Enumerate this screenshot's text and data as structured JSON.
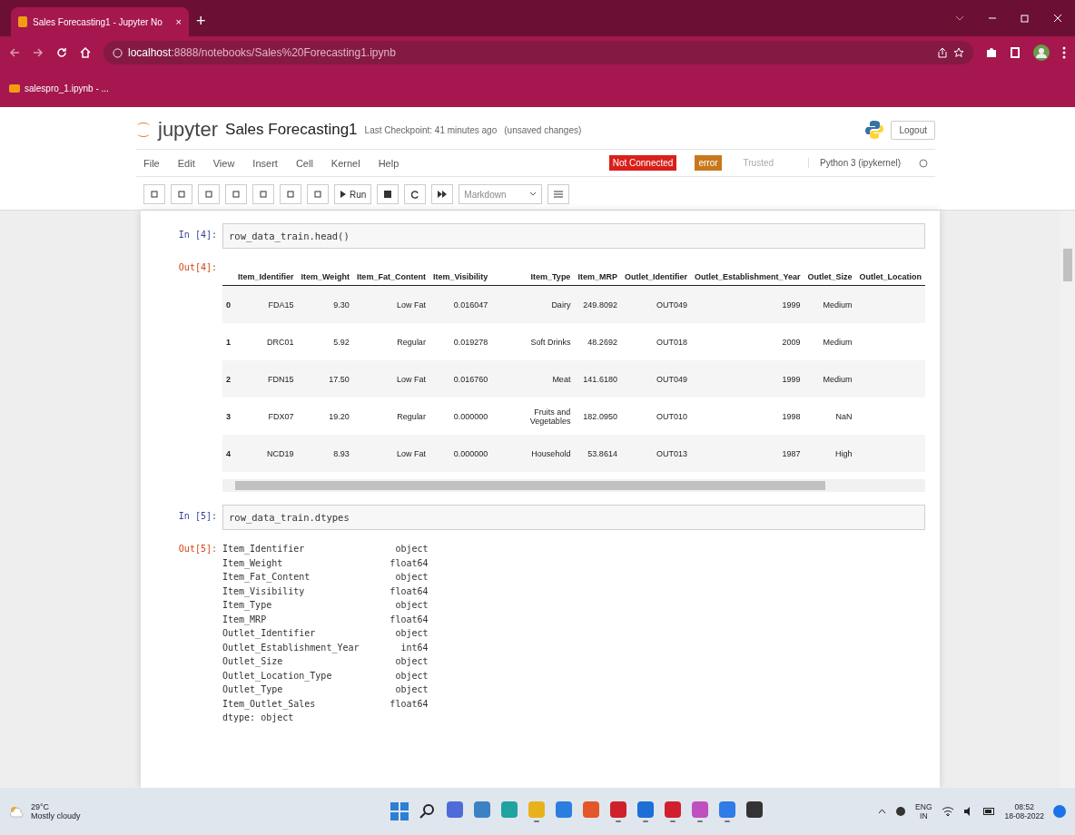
{
  "browser": {
    "tab": {
      "title": "Sales Forecasting1 - Jupyter No",
      "close": "×"
    },
    "new_tab": "+",
    "address": {
      "host": "localhost",
      "path": ":8888/notebooks/Sales%20Forecasting1.ipynb"
    },
    "bookmarks": [
      {
        "label": "salespro_1.ipynb - ..."
      }
    ]
  },
  "header": {
    "logo": "jupyter",
    "title": "Sales Forecasting1",
    "checkpoint": "Last Checkpoint: 41 minutes ago",
    "unsaved": "(unsaved changes)",
    "logout": "Logout"
  },
  "menu": [
    "File",
    "Edit",
    "View",
    "Insert",
    "Cell",
    "Kernel",
    "Help"
  ],
  "indicators": [
    {
      "label": "Not Connected",
      "kind": "danger"
    },
    {
      "label": "error",
      "kind": "warning"
    },
    {
      "label": "Trusted",
      "kind": "plain"
    }
  ],
  "kernel": "Python 3 (ipykernel)",
  "toolbar": {
    "run": "Run",
    "cell_type": "Markdown"
  },
  "cells": [
    {
      "kind": "table",
      "prompt_in": "In [4]:",
      "code": "row_data_train.head()",
      "prompt_out": "Out[4]:",
      "columns": [
        "Item_Identifier",
        "Item_Weight",
        "Item_Fat_Content",
        "Item_Visibility",
        "Item_Type",
        "Item_MRP",
        "Outlet_Identifier",
        "Outlet_Establishment_Year",
        "Outlet_Size",
        "Outlet_Location"
      ],
      "rows": [
        {
          "index": "0",
          "cells": [
            "FDA15",
            "9.30",
            "Low Fat",
            "0.016047",
            "Dairy",
            "249.8092",
            "OUT049",
            "1999",
            "Medium",
            ""
          ]
        },
        {
          "index": "1",
          "cells": [
            "DRC01",
            "5.92",
            "Regular",
            "0.019278",
            "Soft Drinks",
            "48.2692",
            "OUT018",
            "2009",
            "Medium",
            ""
          ]
        },
        {
          "index": "2",
          "cells": [
            "FDN15",
            "17.50",
            "Low Fat",
            "0.016760",
            "Meat",
            "141.6180",
            "OUT049",
            "1999",
            "Medium",
            ""
          ]
        },
        {
          "index": "3",
          "cells": [
            "FDX07",
            "19.20",
            "Regular",
            "0.000000",
            "Fruits and Vegetables",
            "182.0950",
            "OUT010",
            "1998",
            "NaN",
            ""
          ]
        },
        {
          "index": "4",
          "cells": [
            "NCD19",
            "8.93",
            "Low Fat",
            "0.000000",
            "Household",
            "53.8614",
            "OUT013",
            "1987",
            "High",
            ""
          ]
        }
      ]
    },
    {
      "kind": "text",
      "prompt_in": "In [5]:",
      "code": "row_data_train.dtypes",
      "prompt_out": "Out[5]:",
      "lines": [
        [
          "Item_Identifier",
          "object"
        ],
        [
          "Item_Weight",
          "float64"
        ],
        [
          "Item_Fat_Content",
          "object"
        ],
        [
          "Item_Visibility",
          "float64"
        ],
        [
          "Item_Type",
          "object"
        ],
        [
          "Item_MRP",
          "float64"
        ],
        [
          "Outlet_Identifier",
          "object"
        ],
        [
          "Outlet_Establishment_Year",
          "int64"
        ],
        [
          "Outlet_Size",
          "object"
        ],
        [
          "Outlet_Location_Type",
          "object"
        ],
        [
          "Outlet_Type",
          "object"
        ],
        [
          "Item_Outlet_Sales",
          "float64"
        ]
      ],
      "footer": "dtype: object"
    }
  ],
  "taskbar": {
    "weather": {
      "temp": "29°C",
      "condition": "Mostly cloudy"
    },
    "apps": [
      {
        "color": "#4f6bd8",
        "running": false
      },
      {
        "color": "#3b82c4",
        "running": false
      },
      {
        "color": "#1fa3a0",
        "running": false
      },
      {
        "color": "#e8b21c",
        "running": true
      },
      {
        "color": "#2b7de0",
        "running": false
      },
      {
        "color": "#e3562a",
        "running": false
      },
      {
        "color": "#d0202b",
        "running": true
      },
      {
        "color": "#1b6fd6",
        "running": true
      },
      {
        "color": "#d0202b",
        "running": true
      },
      {
        "color": "#c04fc0",
        "running": true
      },
      {
        "color": "#2f7be8",
        "running": true
      },
      {
        "color": "#333333",
        "running": false
      }
    ],
    "lang": "ENG",
    "region": "IN",
    "time": "08:52",
    "date": "18-08-2022"
  }
}
